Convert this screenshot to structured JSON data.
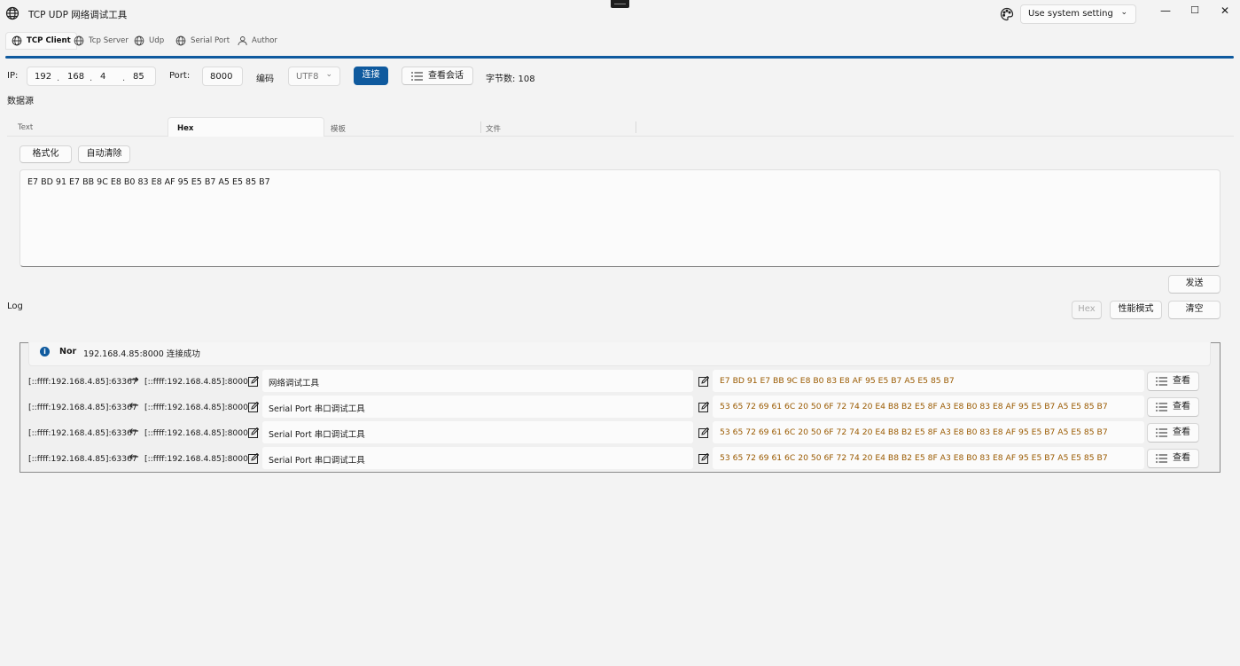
{
  "window": {
    "title": "TCP UDP 网络调试工具",
    "theme_select": "Use system setting",
    "min_glyph": "—",
    "max_glyph": "☐",
    "close_glyph": "✕"
  },
  "tabs": [
    {
      "label": "TCP Client",
      "icon": "globe-icon",
      "active": true
    },
    {
      "label": "Tcp Server",
      "icon": "globe-icon"
    },
    {
      "label": "Udp",
      "icon": "globe-icon"
    },
    {
      "label": "Serial Port",
      "icon": "globe-icon"
    },
    {
      "label": "Author",
      "icon": "person-icon"
    }
  ],
  "connection": {
    "ip_label": "IP:",
    "ip": [
      "192",
      "168",
      "4",
      "85"
    ],
    "port_label": "Port:",
    "port": "8000",
    "encoding_label": "编码",
    "encoding": "UTF8",
    "connect_button": "连接",
    "view_session_button": "查看会话",
    "byte_count": "字节数: 108"
  },
  "datasource": {
    "label": "数据源",
    "tabs": [
      "Text",
      "Hex",
      "模板",
      "文件"
    ],
    "active_tab": "Hex",
    "format_button": "格式化",
    "auto_clear_button": "自动清除",
    "content": "E7 BD 91 E7   BB 9C E8 B0   83 E8 AF 95   E5 B7 A5 E5   85 B7",
    "send_button": "发送"
  },
  "log": {
    "label": "Log",
    "hex_button": "Hex",
    "perf_button": "性能模式",
    "clear_button": "清空",
    "info": {
      "level": "Nor",
      "message": "192.168.4.85:8000 连接成功"
    },
    "rows": [
      {
        "local": "[::ffff:192.168.4.85]:63367",
        "direction": "→",
        "remote": "[::ffff:192.168.4.85]:8000",
        "text": "网络调试工具",
        "hex": "E7 BD 91 E7  BB 9C E8 B0  83 E8 AF 95  E5 B7 A5 E5  85 B7",
        "view": "查看"
      },
      {
        "local": "[::ffff:192.168.4.85]:63367",
        "direction": "←",
        "remote": "[::ffff:192.168.4.85]:8000",
        "text": "Serial Port 串口调试工具",
        "hex": "53 65 72 69  61 6C 20 50  6F 72 74 20  E4 B8 B2 E5  8F A3 E8 B0  83 E8 AF 95  E5 B7 A5 E5  85 B7",
        "view": "查看"
      },
      {
        "local": "[::ffff:192.168.4.85]:63367",
        "direction": "←",
        "remote": "[::ffff:192.168.4.85]:8000",
        "text": "Serial Port 串口调试工具",
        "hex": "53 65 72 69  61 6C 20 50  6F 72 74 20  E4 B8 B2 E5  8F A3 E8 B0  83 E8 AF 95  E5 B7 A5 E5  85 B7",
        "view": "查看"
      },
      {
        "local": "[::ffff:192.168.4.85]:63367",
        "direction": "←",
        "remote": "[::ffff:192.168.4.85]:8000",
        "text": "Serial Port 串口调试工具",
        "hex": "53 65 72 69  61 6C 20 50  6F 72 74 20  E4 B8 B2 E5  8F A3 E8 B0  83 E8 AF 95  E5 B7 A5 E5  85 B7",
        "view": "查看"
      }
    ]
  },
  "colors": {
    "accent": "#0f5a9e",
    "hex_text": "#9a5a00"
  }
}
